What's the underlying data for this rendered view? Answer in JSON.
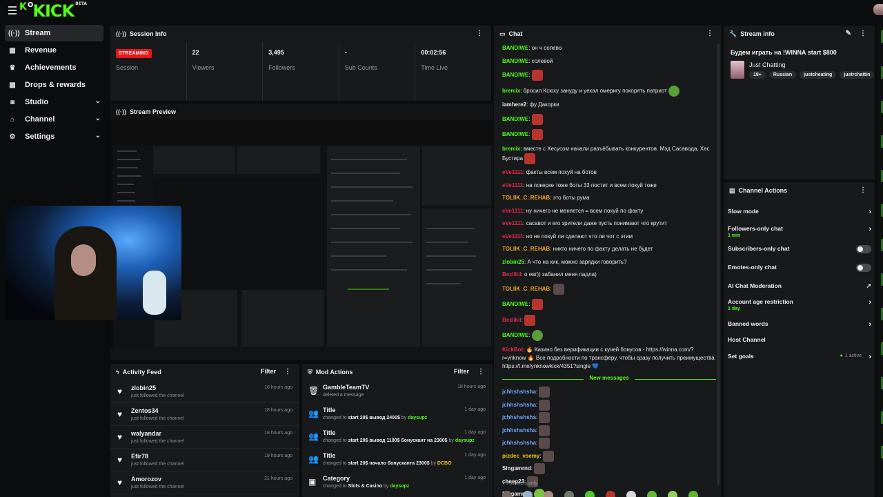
{
  "app": {
    "logo_text": "KICK",
    "logo_prefix": "K",
    "logo_o": "O",
    "logo_badge": "BETA"
  },
  "sidebar": {
    "items": [
      {
        "label": "Stream",
        "icon": "broadcast-icon",
        "glyph": "((·))",
        "active": true,
        "chevron": false
      },
      {
        "label": "Revenue",
        "icon": "revenue-icon",
        "glyph": "▦",
        "active": false,
        "chevron": false
      },
      {
        "label": "Achievements",
        "icon": "trophy-icon",
        "glyph": "♛",
        "active": false,
        "chevron": false
      },
      {
        "label": "Drops & rewards",
        "icon": "gift-icon",
        "glyph": "▩",
        "active": false,
        "chevron": false
      },
      {
        "label": "Studio",
        "icon": "studio-icon",
        "glyph": "◙",
        "active": false,
        "chevron": true
      },
      {
        "label": "Channel",
        "icon": "channel-icon",
        "glyph": "⌂",
        "active": false,
        "chevron": true
      },
      {
        "label": "Settings",
        "icon": "gear-icon",
        "glyph": "⚙",
        "active": false,
        "chevron": true
      }
    ]
  },
  "session_info": {
    "title": "Session Info",
    "cells": [
      {
        "value": "STREAMING",
        "label": "Session",
        "is_badge": true
      },
      {
        "value": "22",
        "label": "Viewers"
      },
      {
        "value": "3,495",
        "label": "Followers"
      },
      {
        "value": "-",
        "label": "Sub Counts"
      },
      {
        "value": "00:02:56",
        "label": "Time Live"
      }
    ]
  },
  "stream_preview": {
    "title": "Stream Preview"
  },
  "activity_feed": {
    "title": "Activity Feed",
    "filter_label": "Filter",
    "items": [
      {
        "name": "zlobin25",
        "sub": "just followed the channel",
        "time": "16 hours ago"
      },
      {
        "name": "Zentos34",
        "sub": "just followed the channel",
        "time": "18 hours ago"
      },
      {
        "name": "walyandar",
        "sub": "just followed the channel",
        "time": "18 hours ago"
      },
      {
        "name": "Efir78",
        "sub": "just followed the channel",
        "time": "19 hours ago"
      },
      {
        "name": "Amorozov",
        "sub": "just followed the channel",
        "time": "21 hours ago"
      }
    ]
  },
  "mod_actions": {
    "title": "Mod Actions",
    "filter_label": "Filter",
    "items": [
      {
        "name": "GambleTeamTV",
        "pre": "deleted a message",
        "bold": "",
        "by": "",
        "user": "",
        "time": "18 hours ago",
        "icon": "trash-icon",
        "glyph": "🗑"
      },
      {
        "name": "Title",
        "pre": "changed to ",
        "bold": "start 20$ вывод 2400$",
        "by": " by ",
        "user": "daysupz",
        "time": "1 day ago",
        "icon": "user-edit-icon",
        "glyph": "👥"
      },
      {
        "name": "Title",
        "pre": "changed to ",
        "bold": "start 20$ вывод 1100$ бонуcкант на 2300$",
        "by": " by ",
        "user": "daysupz",
        "time": "1 day ago",
        "icon": "user-edit-icon",
        "glyph": "👥"
      },
      {
        "name": "Title",
        "pre": "changed to ",
        "bold": "start 20$ начало бонусканта 2300$",
        "by": " by ",
        "user": "DCBO",
        "time": "1 day ago",
        "icon": "user-edit-icon",
        "glyph": "👥"
      },
      {
        "name": "Category",
        "pre": "changed to ",
        "bold": "Slots & Casino",
        "by": " by ",
        "user": "daysupz",
        "time": "1 day ago",
        "icon": "category-icon",
        "glyph": "▣"
      }
    ]
  },
  "chat": {
    "title": "Chat",
    "new_messages_label": "New messages",
    "followers_only_label": "Followers only",
    "messages": [
      {
        "user": "BANDIWE",
        "color": "#53fc18",
        "text": "он ч солево",
        "emote": ""
      },
      {
        "user": "BANDIWE",
        "color": "#53fc18",
        "text": "солевой",
        "emote": ""
      },
      {
        "user": "BANDIWE",
        "color": "#53fc18",
        "text": "",
        "emote": "red"
      },
      {
        "user": "bremix",
        "color": "#53fc18",
        "text": "бросил Ксюху зануду и уехал омеригу покорять патриот",
        "emote": "pepe"
      },
      {
        "user": "iamhere2",
        "color": "#e9e9e9",
        "text": "фу Дакорки",
        "emote": ""
      },
      {
        "user": "BANDIWE",
        "color": "#53fc18",
        "text": "",
        "emote": "red"
      },
      {
        "user": "BANDIWE",
        "color": "#53fc18",
        "text": "",
        "emote": "red"
      },
      {
        "user": "bremix",
        "color": "#53fc18",
        "text": "вместе с Хесусом начали разъёбывать конкурентов. Мэд Сасавода, Хес Бустира",
        "emote": "red"
      },
      {
        "user": "eVe1111",
        "color": "#e8264b",
        "text": "факты всем похуй на ботов",
        "emote": ""
      },
      {
        "user": "eVe1111",
        "color": "#e8264b",
        "text": "на покерке тоже боты 33 постит и всем похуй тоже",
        "emote": ""
      },
      {
        "user": "TOLIIK_C_REHAB",
        "color": "#f5a623",
        "text": "это боты рума",
        "emote": ""
      },
      {
        "user": "eVe1111",
        "color": "#e8264b",
        "text": "ну ничего не меняется = всем похуй по факту",
        "emote": ""
      },
      {
        "user": "eVe1111",
        "color": "#e8264b",
        "text": "сасавот и его зрители даже пусть понимают что крутит",
        "emote": ""
      },
      {
        "user": "eVe1111",
        "color": "#e8264b",
        "text": "но не похуй ли сделают что ли чот с этим",
        "emote": ""
      },
      {
        "user": "TOLIIK_C_REHAB",
        "color": "#f5a623",
        "text": "никто ничего по факту делать не будет",
        "emote": ""
      },
      {
        "user": "zlobin25",
        "color": "#53fc18",
        "text": "А что на кик, можно зарядки говорить?",
        "emote": ""
      },
      {
        "user": "Bezlikii",
        "color": "#e8264b",
        "text": "о евг)) забанил меня падла)",
        "emote": ""
      },
      {
        "user": "TOLIIK_C_REHAB",
        "color": "#f5a623",
        "text": "",
        "emote": "dark"
      },
      {
        "user": "BANDIWE",
        "color": "#53fc18",
        "text": "",
        "emote": "red"
      },
      {
        "user": "Bezlikii",
        "color": "#e8264b",
        "text": "",
        "emote": "red"
      },
      {
        "user": "BANDIWE",
        "color": "#53fc18",
        "text": "",
        "emote": "pepe"
      },
      {
        "user": "KickBot",
        "color": "#e8264b",
        "text": "🔥 Казино без верификации с кучей бонусов - https://winna.com/?r=ynknow 🔥 Все подробности по трансферу, чтобы сразу получить преимущества https://t.me/ynknowkick/4351?single 💙",
        "emote": ""
      }
    ],
    "new_messages": [
      {
        "user": "jchhshshsha",
        "color": "#6fa8ff",
        "emote": "dark"
      },
      {
        "user": "jchhshshsha",
        "color": "#6fa8ff",
        "emote": "dark"
      },
      {
        "user": "jchhshshsha",
        "color": "#6fa8ff",
        "emote": "dark"
      },
      {
        "user": "jchhshshsha",
        "color": "#6fa8ff",
        "emote": "dark"
      },
      {
        "user": "jchhshshsha",
        "color": "#6fa8ff",
        "emote": "dark"
      },
      {
        "user": "pizdec_vsemy",
        "color": "#f5c518",
        "emote": "dark"
      },
      {
        "user": "Singamrnd",
        "color": "#e9e9e9",
        "emote": "dark"
      },
      {
        "user": "cheep23",
        "color": "#e9e9e9",
        "emote": "dark"
      },
      {
        "user": "Singamrnd",
        "color": "#e9e9e9",
        "emote": "green"
      }
    ]
  },
  "stream_info": {
    "title": "Stream info",
    "stream_title": "Будем играть на !WINNA start $800",
    "category": "Just Chatting",
    "tags": [
      "18+",
      "Russian",
      "justcheating",
      "justrchattin"
    ]
  },
  "channel_actions": {
    "title": "Channel Actions",
    "items": [
      {
        "label": "Slow mode",
        "sub": "",
        "control": "chevron"
      },
      {
        "label": "Followers-only chat",
        "sub": "1 min",
        "control": "chevron"
      },
      {
        "label": "Subscribers-only chat",
        "sub": "",
        "control": "toggle"
      },
      {
        "label": "Emotes-only chat",
        "sub": "",
        "control": "toggle"
      },
      {
        "label": "AI Chat Moderation",
        "sub": "",
        "control": "external"
      },
      {
        "label": "Account age restriction",
        "sub": "1 day",
        "control": "chevron"
      },
      {
        "label": "Banned words",
        "sub": "",
        "control": "chevron"
      },
      {
        "label": "Host Channel",
        "sub": "",
        "control": "none"
      },
      {
        "label": "Set goals",
        "sub": "",
        "control": "chevron",
        "active_label": "1 active"
      }
    ]
  },
  "colors": {
    "accent": "#53fc18",
    "live": "#e8161b",
    "panel": "#17191b",
    "bg": "#0b0c0d"
  }
}
